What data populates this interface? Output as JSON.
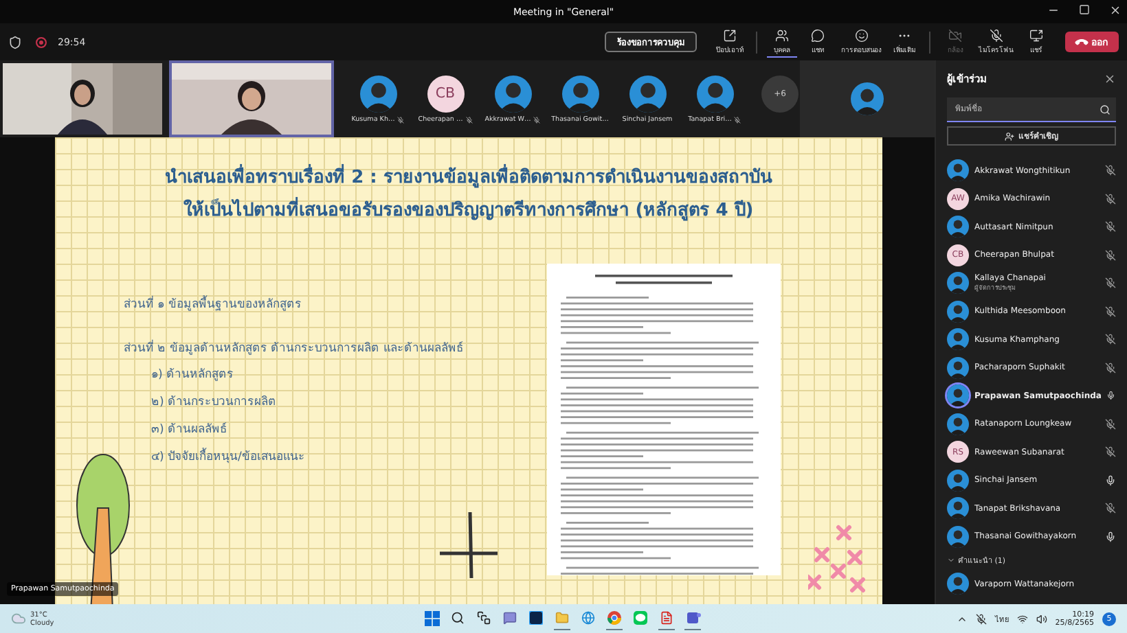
{
  "window": {
    "title": "Meeting in \"General\""
  },
  "meeting": {
    "timer": "29:54",
    "recording": true
  },
  "toolbar": {
    "request_control": "ร้องขอการควบคุม",
    "tools": [
      {
        "kind": "popout",
        "label": "ป๊อปเอาท์",
        "selected": false,
        "disabled": false
      },
      {
        "kind": "people",
        "label": "บุคคล",
        "selected": true,
        "disabled": false
      },
      {
        "kind": "chat",
        "label": "แชท",
        "selected": false,
        "disabled": false
      },
      {
        "kind": "reactions",
        "label": "การตอบสนอง",
        "selected": false,
        "disabled": false
      },
      {
        "kind": "more",
        "label": "เพิ่มเติม",
        "selected": false,
        "disabled": false
      },
      {
        "kind": "camera",
        "label": "กล้อง",
        "selected": false,
        "disabled": true
      },
      {
        "kind": "mic",
        "label": "ไมโครโฟน",
        "selected": false,
        "disabled": false
      },
      {
        "kind": "share",
        "label": "แชร์",
        "selected": false,
        "disabled": false
      }
    ],
    "leave": "ออก"
  },
  "video_tiles": [
    {
      "selected": false
    },
    {
      "selected": true
    }
  ],
  "strip_avatars": [
    {
      "name": "Kusuma Kh…",
      "muted": true
    },
    {
      "name": "Cheerapan …",
      "kind": "initials",
      "initials": "CB",
      "muted": true
    },
    {
      "name": "Akkrawat W…",
      "muted": true
    },
    {
      "name": "Thasanai Gowit…",
      "muted": false
    },
    {
      "name": "Sinchai Jansem",
      "muted": false
    },
    {
      "name": "Tanapat Bri…",
      "muted": true
    }
  ],
  "strip_overflow": "+6",
  "slide": {
    "title": [
      "นำเสนอเพื่อทราบเรื่องที่ 2 : รายงานข้อมูลเพื่อติดตามการดำเนินงานของสถาบัน",
      "ให้เป็นไปตามที่เสนอขอรับรองของปริญญาตรีทางการศึกษา (หลักสูตร 4 ปี)"
    ],
    "sections": [
      {
        "heading": "ส่วนที่ ๑ ข้อมูลพื้นฐานของหลักสูตร"
      },
      {
        "heading": "ส่วนที่ ๒ ข้อมูลด้านหลักสูตร ด้านกระบวนการผลิต และด้านผลลัพธ์",
        "items": [
          "๑) ด้านหลักสูตร",
          "๒) ด้านกระบวนการผลิต",
          "๓) ด้านผลลัพธ์",
          "๔) ปัจจัยเกื้อหนุน/ข้อเสนอแนะ"
        ]
      }
    ]
  },
  "speaker_label": "Prapawan Samutpaochinda",
  "panel": {
    "title": "ผู้เข้าร่วม",
    "search": {
      "placeholder": "พิมพ์ชื่อ"
    },
    "invite": "แชร์คำเชิญ",
    "participants": [
      {
        "name": "Akkrawat Wongthitikun",
        "muted": true,
        "speaking": false
      },
      {
        "name": "Amika Wachirawin",
        "kind": "initials",
        "initials": "AW",
        "muted": true,
        "speaking": false
      },
      {
        "name": "Auttasart Nimitpun",
        "muted": true,
        "speaking": false
      },
      {
        "name": "Cheerapan Bhulpat",
        "kind": "initials",
        "initials": "CB",
        "muted": true,
        "speaking": false
      },
      {
        "name": "Kallaya Chanapai",
        "role": "ผู้จัดการประชุม",
        "muted": true,
        "speaking": false
      },
      {
        "name": "Kulthida Meesomboon",
        "muted": true,
        "speaking": false
      },
      {
        "name": "Kusuma Khamphang",
        "muted": true,
        "speaking": false
      },
      {
        "name": "Pacharaporn Suphakit",
        "muted": true,
        "speaking": false
      },
      {
        "name": "Prapawan Samutpaochinda",
        "muted": false,
        "speaking": true
      },
      {
        "name": "Ratanaporn Loungkeaw",
        "muted": true,
        "speaking": false
      },
      {
        "name": "Raweewan Subanarat",
        "kind": "initials",
        "initials": "RS",
        "muted": true,
        "speaking": false
      },
      {
        "name": "Sinchai Jansem",
        "muted": false,
        "speaking": false
      },
      {
        "name": "Tanapat Brikshavana",
        "muted": true,
        "speaking": false
      },
      {
        "name": "Thasanai Gowithayakorn",
        "muted": false,
        "speaking": false
      }
    ],
    "suggested": {
      "label": "คำแนะนำ (1)",
      "expanded": true,
      "people": [
        {
          "name": "Varaporn Wattanakejorn"
        }
      ]
    }
  },
  "taskbar": {
    "weather": {
      "temperature": "31°C",
      "condition": "Cloudy"
    },
    "apps": [
      {
        "kind": "start",
        "running": false
      },
      {
        "kind": "search",
        "running": false
      },
      {
        "kind": "taskview",
        "running": false
      },
      {
        "kind": "chat",
        "running": false
      },
      {
        "kind": "photoshop",
        "running": false
      },
      {
        "kind": "explorer",
        "running": true
      },
      {
        "kind": "edge",
        "running": false
      },
      {
        "kind": "chrome",
        "running": true
      },
      {
        "kind": "line",
        "running": false
      },
      {
        "kind": "acrobat",
        "running": true
      },
      {
        "kind": "teams",
        "running": true
      }
    ],
    "language": "ไทย",
    "time": "10:19",
    "date": "25/8/2565",
    "notifications": "5"
  }
}
